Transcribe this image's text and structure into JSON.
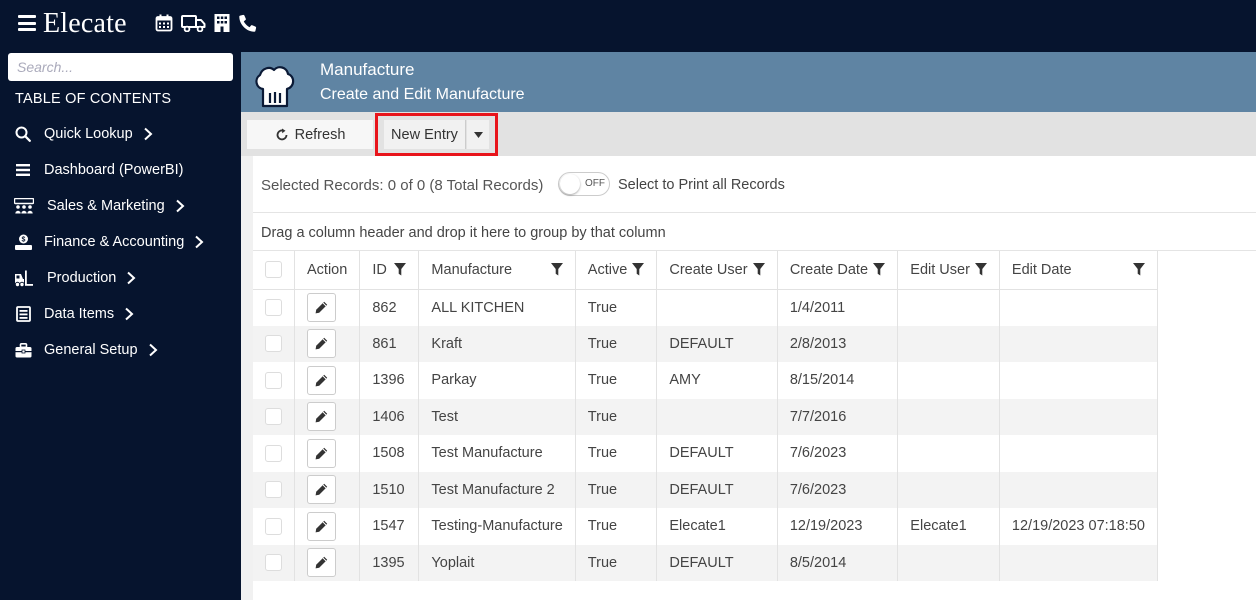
{
  "app": {
    "logo_text": "Elecate",
    "top_icons": [
      "calendar-icon",
      "truck-icon",
      "building-icon",
      "phone-icon"
    ]
  },
  "sidebar": {
    "search_placeholder": "Search...",
    "toc_label": "TABLE OF CONTENTS",
    "items": [
      {
        "label": "Quick Lookup",
        "icon": "search-icon",
        "has_children": true
      },
      {
        "label": "Dashboard (PowerBI)",
        "icon": "menu-lines-icon",
        "has_children": false
      },
      {
        "label": "Sales & Marketing",
        "icon": "people-group-icon",
        "has_children": true
      },
      {
        "label": "Finance & Accounting",
        "icon": "money-hand-icon",
        "has_children": true
      },
      {
        "label": "Production",
        "icon": "forklift-icon",
        "has_children": true
      },
      {
        "label": "Data Items",
        "icon": "list-box-icon",
        "has_children": true
      },
      {
        "label": "General Setup",
        "icon": "toolbox-icon",
        "has_children": true
      }
    ]
  },
  "page": {
    "title": "Manufacture",
    "subtitle": "Create and Edit Manufacture",
    "icon": "chef-hat-icon"
  },
  "toolbar": {
    "refresh_label": "Refresh",
    "new_entry_label": "New Entry"
  },
  "records": {
    "selected_text": "Selected Records: 0 of 0 (8 Total Records)",
    "toggle_text": "OFF",
    "print_text": "Select to Print all Records",
    "group_hint": "Drag a column header and drop it here to group by that column"
  },
  "grid": {
    "headers": {
      "action": "Action",
      "id": "ID",
      "manufacture": "Manufacture",
      "active": "Active",
      "create_user": "Create User",
      "create_date": "Create Date",
      "edit_user": "Edit User",
      "edit_date": "Edit Date"
    },
    "rows": [
      {
        "id": "862",
        "manufacture": "ALL KITCHEN",
        "active": "True",
        "create_user": "",
        "create_date": "1/4/2011",
        "edit_user": "",
        "edit_date": ""
      },
      {
        "id": "861",
        "manufacture": "Kraft",
        "active": "True",
        "create_user": "DEFAULT",
        "create_date": "2/8/2013",
        "edit_user": "",
        "edit_date": ""
      },
      {
        "id": "1396",
        "manufacture": "Parkay",
        "active": "True",
        "create_user": "AMY",
        "create_date": "8/15/2014",
        "edit_user": "",
        "edit_date": ""
      },
      {
        "id": "1406",
        "manufacture": "Test",
        "active": "True",
        "create_user": "",
        "create_date": "7/7/2016",
        "edit_user": "",
        "edit_date": ""
      },
      {
        "id": "1508",
        "manufacture": "Test Manufacture",
        "active": "True",
        "create_user": "DEFAULT",
        "create_date": "7/6/2023",
        "edit_user": "",
        "edit_date": ""
      },
      {
        "id": "1510",
        "manufacture": "Test Manufacture 2",
        "active": "True",
        "create_user": "DEFAULT",
        "create_date": "7/6/2023",
        "edit_user": "",
        "edit_date": ""
      },
      {
        "id": "1547",
        "manufacture": "Testing-Manufacture",
        "active": "True",
        "create_user": "Elecate1",
        "create_date": "12/19/2023",
        "edit_user": "Elecate1",
        "edit_date": "12/19/2023 07:18:50"
      },
      {
        "id": "1395",
        "manufacture": "Yoplait",
        "active": "True",
        "create_user": "DEFAULT",
        "create_date": "8/5/2014",
        "edit_user": "",
        "edit_date": ""
      }
    ]
  },
  "colors": {
    "nav_bg": "#06142e",
    "header_bg": "#5f84a3",
    "highlight": "#e8141b"
  }
}
